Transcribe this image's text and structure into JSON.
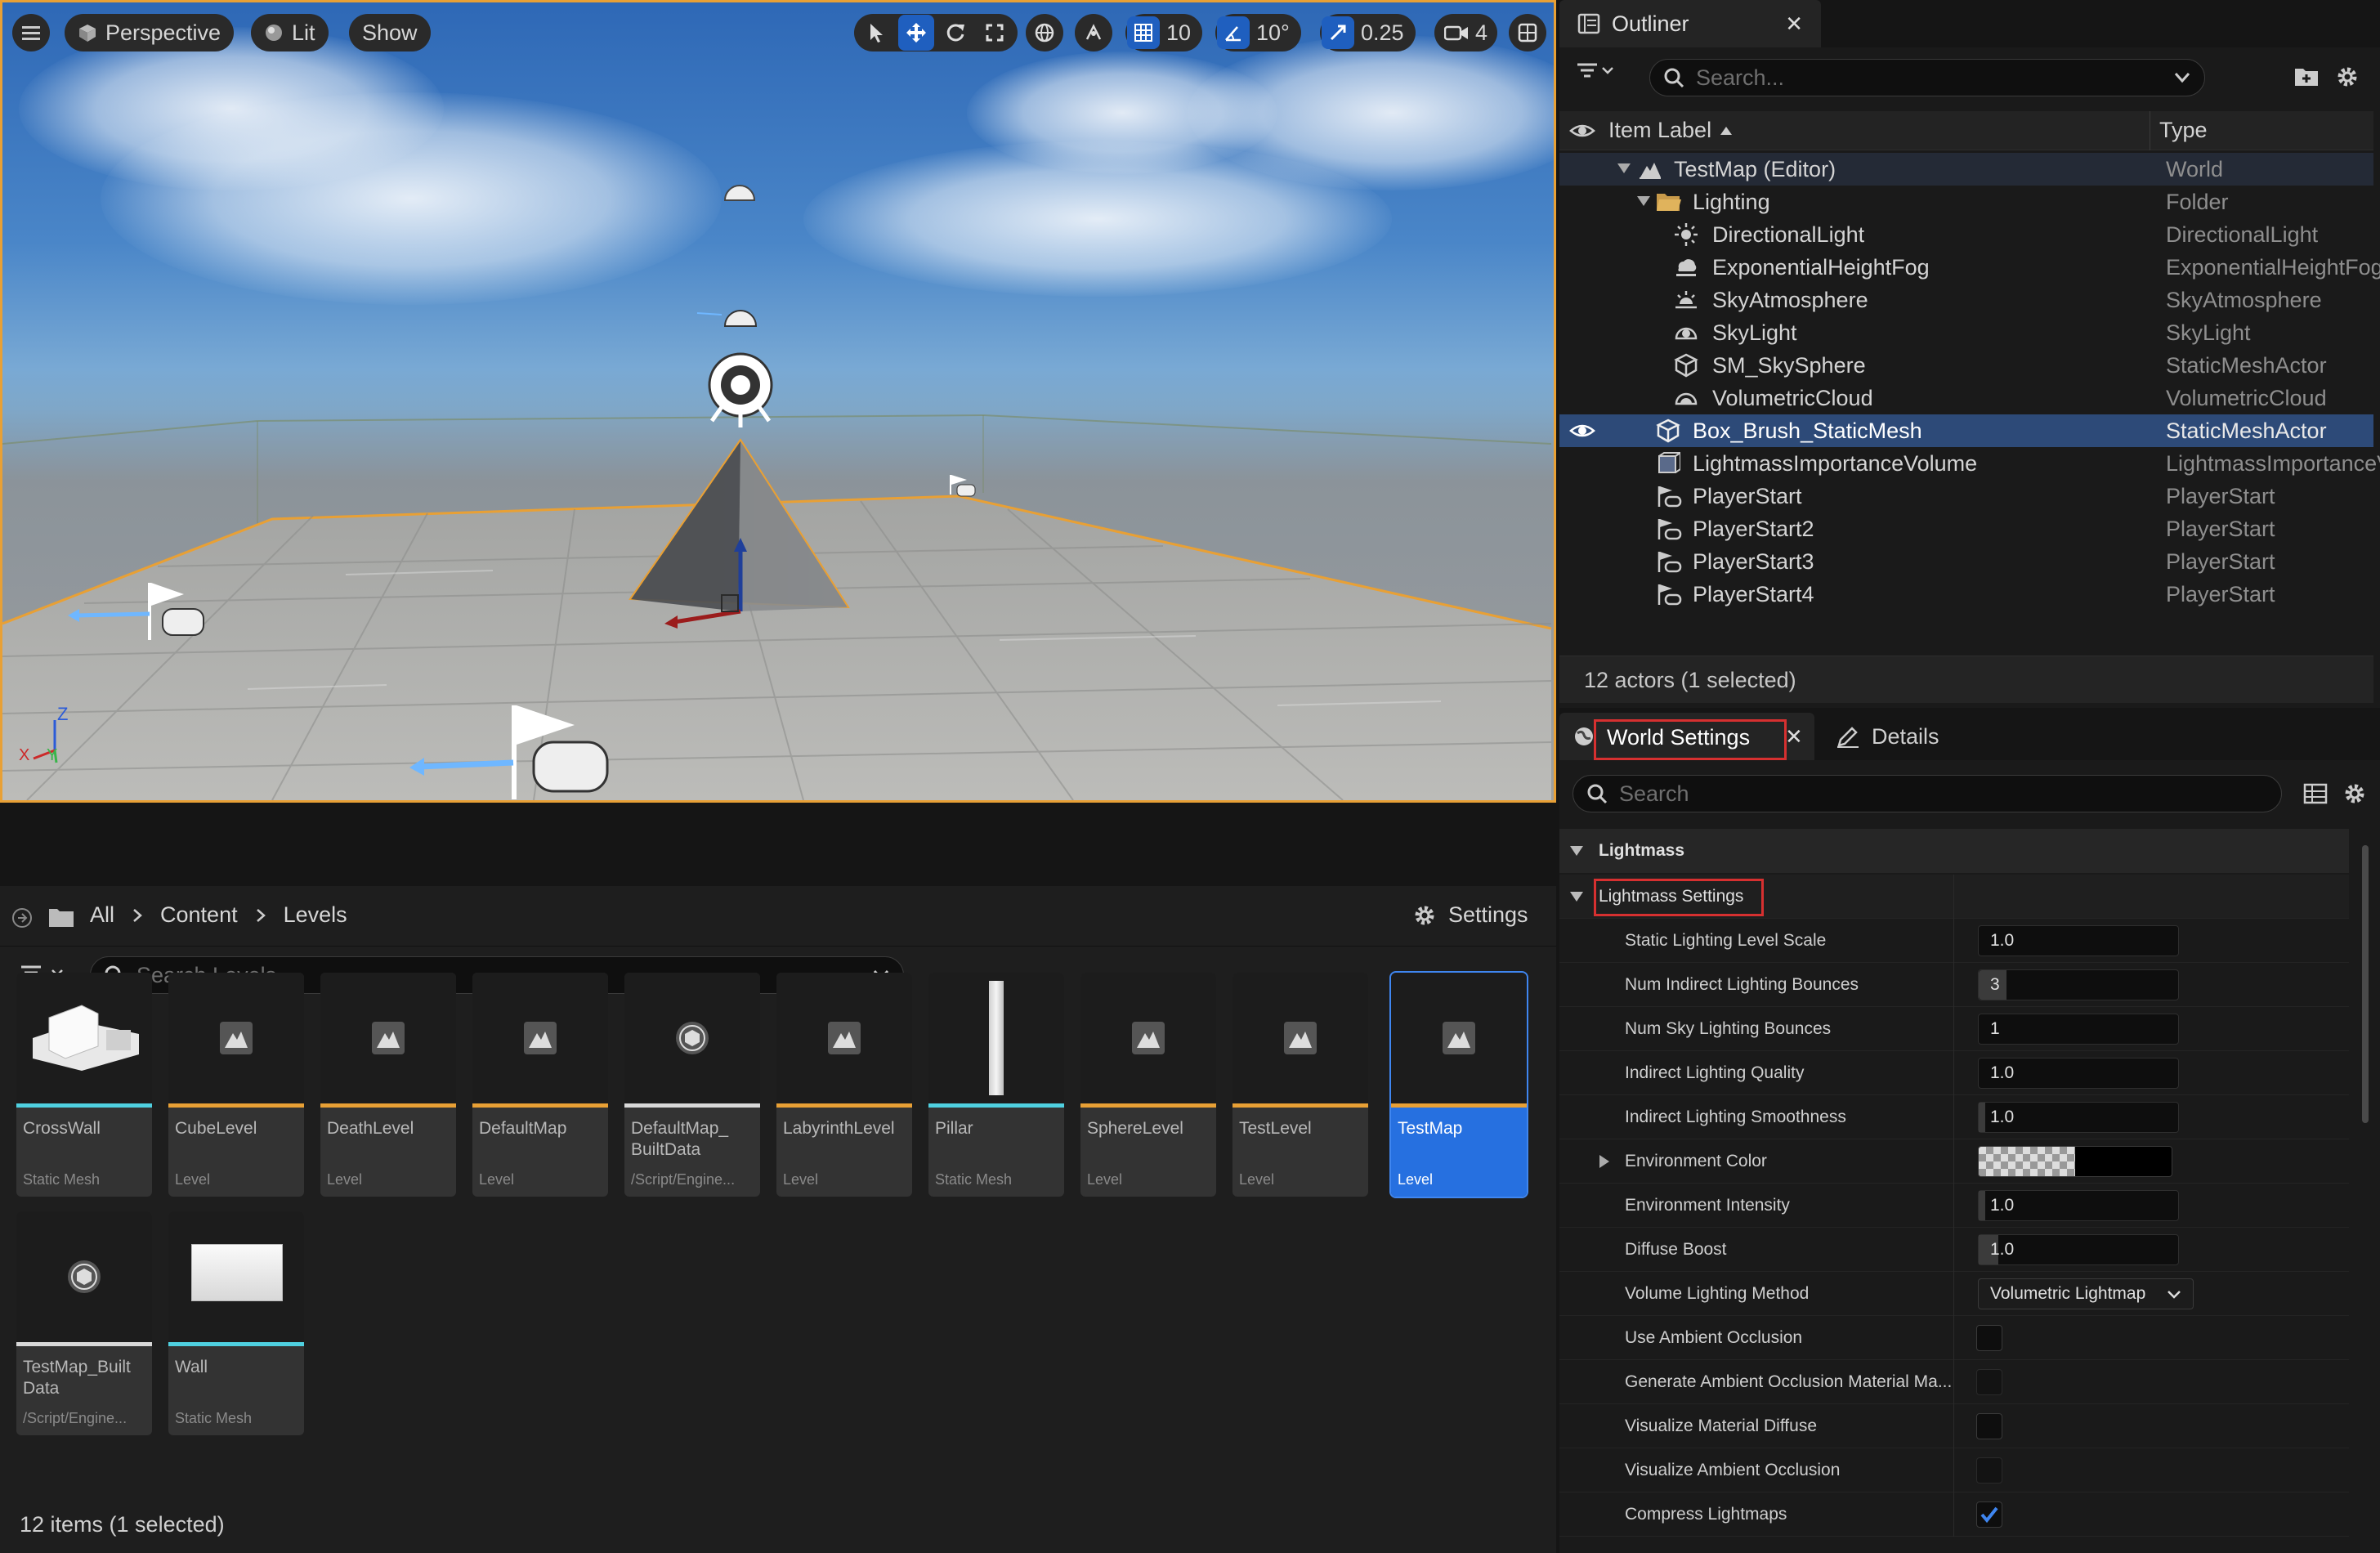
{
  "viewport": {
    "menu_icon": "hamburger-icon",
    "perspective_label": "Perspective",
    "lit_label": "Lit",
    "show_label": "Show",
    "grid_snap_value": "10",
    "rotation_snap_value": "10°",
    "scale_snap_value": "0.25",
    "camera_speed_value": "4",
    "axis_labels": {
      "z": "Z",
      "y": "Y",
      "x": "X"
    },
    "selection_color": "#e8a035"
  },
  "outliner": {
    "tab_label": "Outliner",
    "search_placeholder": "Search...",
    "col_label": "Item Label",
    "col_type": "Type",
    "rows": [
      {
        "label": "TestMap (Editor)",
        "type": "World"
      },
      {
        "label": "Lighting",
        "type": "Folder"
      },
      {
        "label": "DirectionalLight",
        "type": "DirectionalLight"
      },
      {
        "label": "ExponentialHeightFog",
        "type": "ExponentialHeightFog"
      },
      {
        "label": "SkyAtmosphere",
        "type": "SkyAtmosphere"
      },
      {
        "label": "SkyLight",
        "type": "SkyLight"
      },
      {
        "label": "SM_SkySphere",
        "type": "StaticMeshActor"
      },
      {
        "label": "VolumetricCloud",
        "type": "VolumetricCloud"
      },
      {
        "label": "Box_Brush_StaticMesh",
        "type": "StaticMeshActor"
      },
      {
        "label": "LightmassImportanceVolume",
        "type": "LightmassImportanceVolume"
      },
      {
        "label": "PlayerStart",
        "type": "PlayerStart"
      },
      {
        "label": "PlayerStart2",
        "type": "PlayerStart"
      },
      {
        "label": "PlayerStart3",
        "type": "PlayerStart"
      },
      {
        "label": "PlayerStart4",
        "type": "PlayerStart"
      }
    ],
    "footer": "12 actors (1 selected)"
  },
  "details": {
    "tab_world_settings": "World Settings",
    "tab_details": "Details",
    "search_placeholder": "Search",
    "section_label": "Lightmass",
    "subsection_label": "Lightmass Settings",
    "properties": [
      {
        "label": "Static Lighting Level Scale",
        "value": "1.0"
      },
      {
        "label": "Num Indirect Lighting Bounces",
        "value": "3"
      },
      {
        "label": "Num Sky Lighting Bounces",
        "value": "1"
      },
      {
        "label": "Indirect Lighting Quality",
        "value": "1.0"
      },
      {
        "label": "Indirect Lighting Smoothness",
        "value": "1.0"
      },
      {
        "label": "Environment Color",
        "value": ""
      },
      {
        "label": "Environment Intensity",
        "value": "1.0"
      },
      {
        "label": "Diffuse Boost",
        "value": "1.0"
      },
      {
        "label": "Volume Lighting Method",
        "value": "Volumetric Lightmap"
      },
      {
        "label": "Use Ambient Occlusion",
        "checked": false
      },
      {
        "label": "Generate Ambient Occlusion Material Ma...",
        "checked": false
      },
      {
        "label": "Visualize Material Diffuse",
        "checked": false
      },
      {
        "label": "Visualize Ambient Occlusion",
        "checked": false
      },
      {
        "label": "Compress Lightmaps",
        "checked": true
      }
    ]
  },
  "content_browser": {
    "breadcrumb": [
      "All",
      "Content",
      "Levels"
    ],
    "settings_label": "Settings",
    "search_placeholder": "Search Levels",
    "items": [
      {
        "name": "CrossWall",
        "kind": "Static Mesh"
      },
      {
        "name": "CubeLevel",
        "kind": "Level"
      },
      {
        "name": "DeathLevel",
        "kind": "Level"
      },
      {
        "name": "DefaultMap",
        "kind": "Level"
      },
      {
        "name": "DefaultMap_ BuiltData",
        "kind": "/Script/Engine..."
      },
      {
        "name": "LabyrinthLevel",
        "kind": "Level"
      },
      {
        "name": "Pillar",
        "kind": "Static Mesh"
      },
      {
        "name": "SphereLevel",
        "kind": "Level"
      },
      {
        "name": "TestLevel",
        "kind": "Level"
      },
      {
        "name": "TestMap",
        "kind": "Level"
      },
      {
        "name": "TestMap_Built Data",
        "kind": "/Script/Engine..."
      },
      {
        "name": "Wall",
        "kind": "Static Mesh"
      }
    ],
    "footer": "12 items (1 selected)",
    "bar_colors": {
      "level": "#e8a035",
      "mesh": "#4fd0e0",
      "data": "#d8d8d8"
    }
  },
  "colors": {
    "accent": "#2670e0",
    "highlight_box": "#d63030",
    "checkbox": "#3f86f0"
  }
}
